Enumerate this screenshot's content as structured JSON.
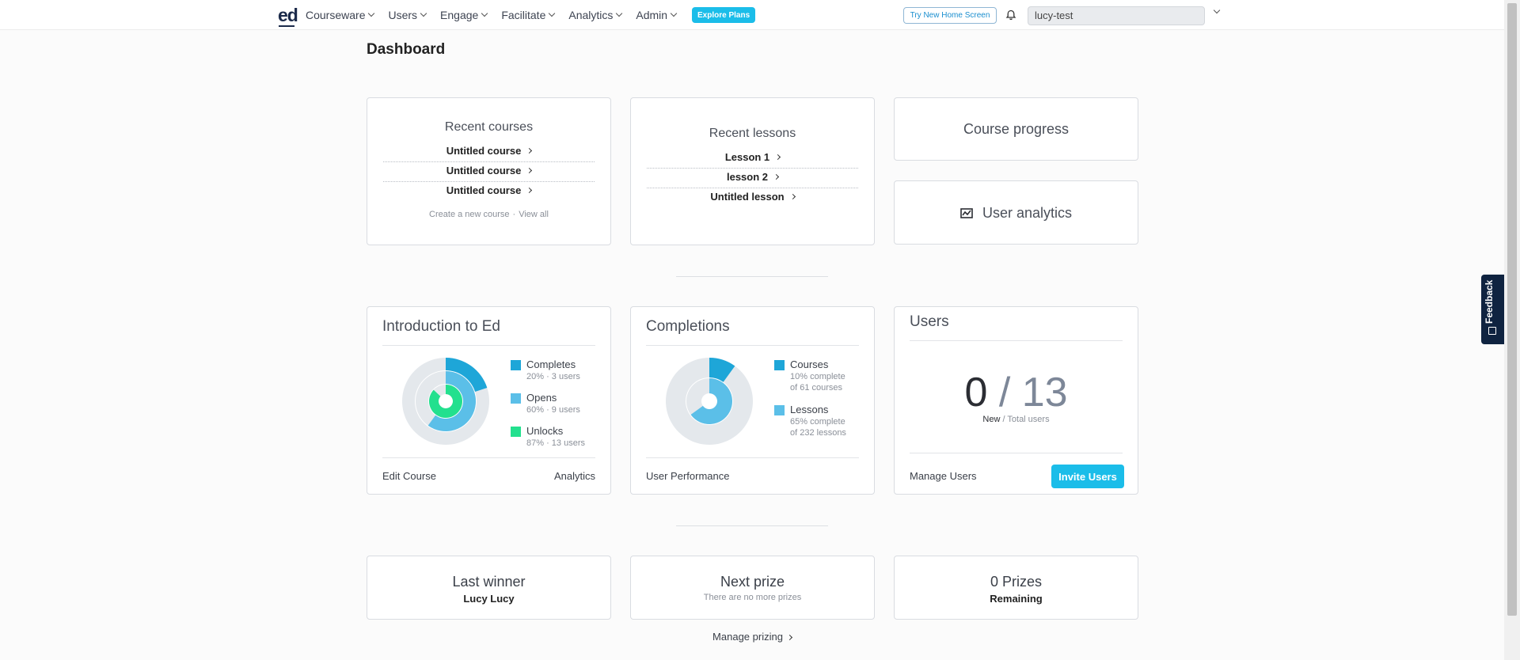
{
  "nav": {
    "logo": "ed",
    "items": [
      {
        "label": "Courseware"
      },
      {
        "label": "Users"
      },
      {
        "label": "Engage"
      },
      {
        "label": "Facilitate"
      },
      {
        "label": "Analytics"
      },
      {
        "label": "Admin"
      }
    ],
    "explore_label": "Explore Plans",
    "try_home_label": "Try New Home Screen",
    "user_value": "lucy-test"
  },
  "feedback_label": "Feedback",
  "page_title": "Dashboard",
  "recent_courses": {
    "title": "Recent courses",
    "items": [
      "Untitled course",
      "Untitled course",
      "Untitled course"
    ],
    "create_link": "Create a new course",
    "separator": "·",
    "view_all": "View all"
  },
  "recent_lessons": {
    "title": "Recent lessons",
    "items": [
      "Lesson 1",
      "lesson 2",
      "Untitled lesson"
    ]
  },
  "course_progress": {
    "title": "Course progress"
  },
  "user_analytics": {
    "title": "User analytics"
  },
  "intro_card": {
    "title": "Introduction to Ed",
    "legend": [
      {
        "name": "Completes",
        "sub": "20% · 3 users",
        "pct": 20,
        "color": "#1ea6d8"
      },
      {
        "name": "Opens",
        "sub": "60% · 9 users",
        "pct": 60,
        "color": "#5bbfe8"
      },
      {
        "name": "Unlocks",
        "sub": "87% · 13 users",
        "pct": 87,
        "color": "#23e08e"
      }
    ],
    "edit_link": "Edit Course",
    "analytics_link": "Analytics"
  },
  "completions_card": {
    "title": "Completions",
    "legend": [
      {
        "name": "Courses",
        "sub": "10% complete",
        "sub2": "of 61 courses",
        "pct": 10,
        "color": "#1ea6d8"
      },
      {
        "name": "Lessons",
        "sub": "65% complete",
        "sub2": "of 232 lessons",
        "pct": 65,
        "color": "#5bbfe8"
      }
    ],
    "performance_link": "User Performance"
  },
  "users_card": {
    "title": "Users",
    "new": "0",
    "slash": "/",
    "total": "13",
    "sub_new": "New",
    "sub_rest": " / Total users",
    "manage_link": "Manage Users",
    "invite_label": "Invite Users"
  },
  "prizes": {
    "last_winner_title": "Last winner",
    "last_winner_name": "Lucy Lucy",
    "next_prize_title": "Next prize",
    "next_prize_sub": "There are no more prizes",
    "count_title": "0 Prizes",
    "count_sub": "Remaining",
    "manage_link": "Manage prizing"
  },
  "colors": {
    "accent": "#1bbde9",
    "ring_bg": "#e4e8ec"
  }
}
